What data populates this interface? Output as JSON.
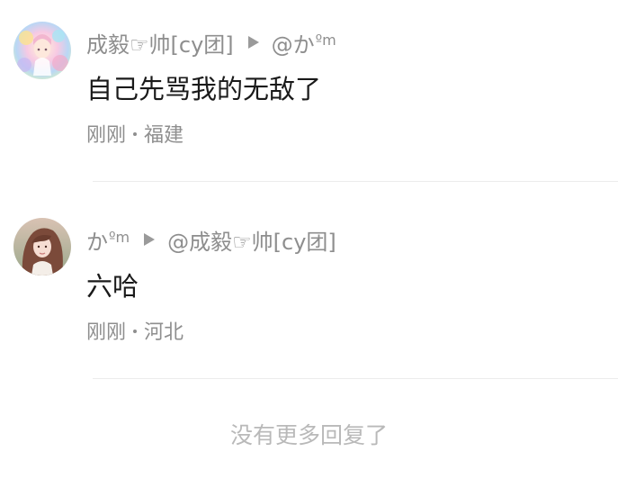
{
  "comments": [
    {
      "avatar_icon": "avatar-colorful-anime",
      "author": "成毅☞帅[cy团]",
      "reply_to_prefix": "@か",
      "reply_to_suffix": "ºm",
      "text": "自己先骂我的无敌了",
      "time": "刚刚",
      "location": "福建"
    },
    {
      "avatar_icon": "avatar-girl-photo",
      "author_prefix": "か",
      "author_suffix": "ºm",
      "reply_to": "@成毅☞帅[cy团]",
      "text": "六哈",
      "time": "刚刚",
      "location": "河北"
    }
  ],
  "footer": {
    "text": "没有更多回复了"
  },
  "colors": {
    "secondary_text": "#8e8e8e",
    "primary_text": "#1a1a1a",
    "footer_text": "#b9b9b9",
    "divider": "#ececec"
  }
}
